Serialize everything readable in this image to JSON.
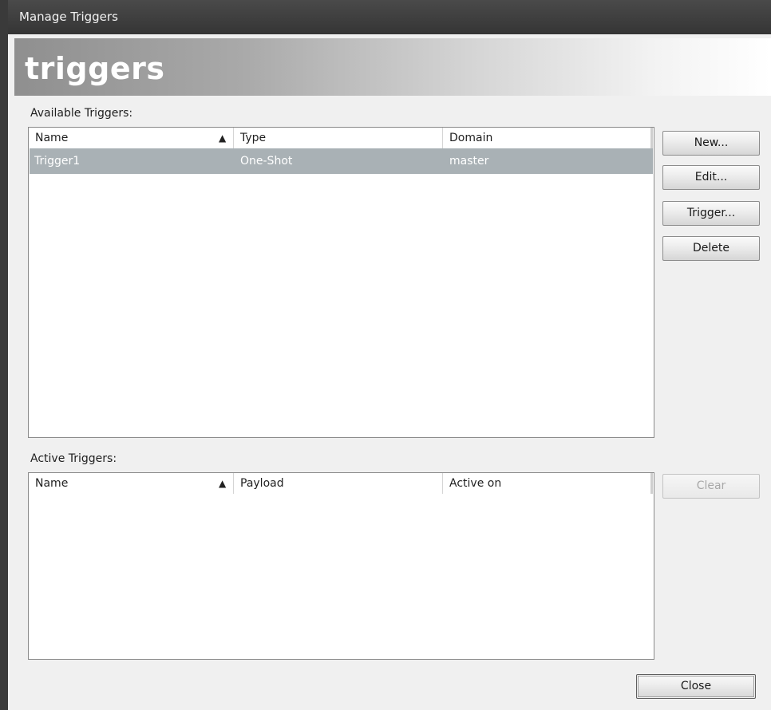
{
  "window": {
    "title": "Manage Triggers"
  },
  "banner": {
    "title": "triggers"
  },
  "available": {
    "label": "Available Triggers:",
    "columns": [
      "Name",
      "Type",
      "Domain"
    ],
    "sort_indicator": "▲",
    "rows": [
      {
        "name": "Trigger1",
        "type": "One-Shot",
        "domain": "master",
        "selected": true
      }
    ]
  },
  "active": {
    "label": "Active Triggers:",
    "columns": [
      "Name",
      "Payload",
      "Active on"
    ],
    "sort_indicator": "▲",
    "rows": []
  },
  "buttons": {
    "new": "New...",
    "edit": "Edit...",
    "trigger": "Trigger...",
    "delete": "Delete",
    "clear": "Clear",
    "close": "Close"
  },
  "colors": {
    "titlebar": "#3d3d3d",
    "selection": "#a9b1b5",
    "dialog_bg": "#f0f0f0"
  }
}
